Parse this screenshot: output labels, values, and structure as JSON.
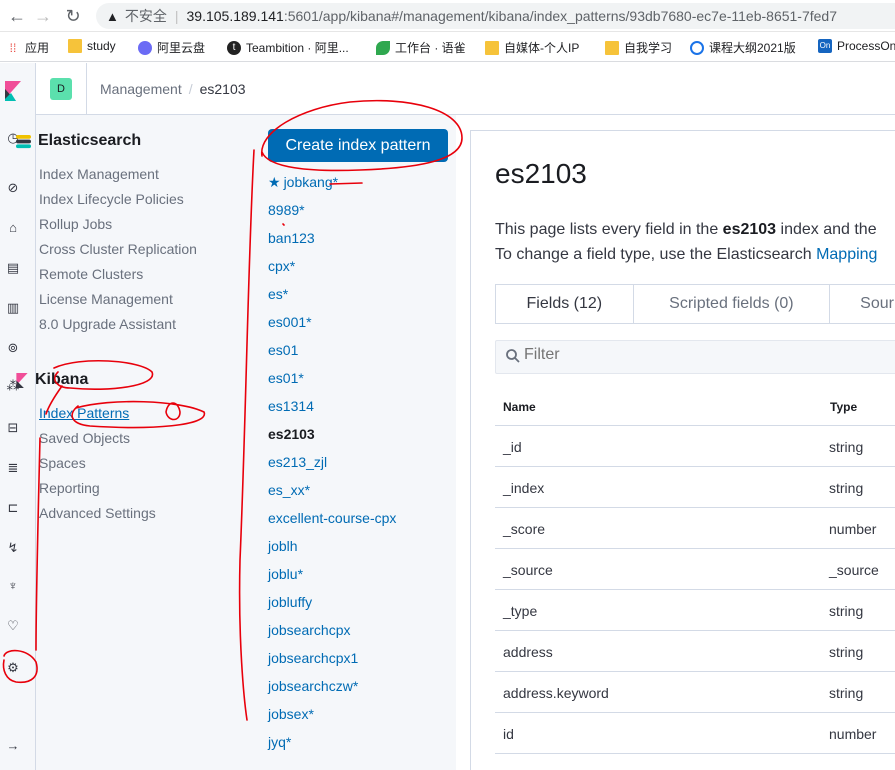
{
  "browser": {
    "insecure_label": "不安全",
    "url_host": "39.105.189.141",
    "url_path": ":5601/app/kibana#/management/kibana/index_patterns/93db7680-ec7e-11eb-8651-7fed7",
    "bookmarks": [
      "应用",
      "study",
      "阿里云盘",
      "Teambition · 阿里...",
      "工作台 · 语雀",
      "自媒体-个人IP",
      "自我学习",
      "课程大纲2021版",
      "ProcessOn"
    ]
  },
  "header": {
    "space_initial": "D",
    "breadcrumb_management": "Management",
    "breadcrumb_separator": "/",
    "breadcrumb_current": "es2103"
  },
  "sidenav": {
    "elasticsearch_title": "Elasticsearch",
    "elasticsearch_items": [
      "Index Management",
      "Index Lifecycle Policies",
      "Rollup Jobs",
      "Cross Cluster Replication",
      "Remote Clusters",
      "License Management",
      "8.0 Upgrade Assistant"
    ],
    "kibana_title": "Kibana",
    "kibana_items": [
      "Index Patterns",
      "Saved Objects",
      "Spaces",
      "Reporting",
      "Advanced Settings"
    ]
  },
  "patterns": {
    "create_label": "Create index pattern",
    "items": [
      "jobkang*",
      "8989*",
      "ban123",
      "cpx*",
      "es*",
      "es001*",
      "es01",
      "es01*",
      "es1314",
      "es2103",
      "es213_zjl",
      "es_xx*",
      "excellent-course-cpx",
      "joblh",
      "joblu*",
      "jobluffy",
      "jobsearchcpx",
      "jobsearchcpx1",
      "jobsearchczw*",
      "jobsex*",
      "jyq*"
    ],
    "current": "es2103"
  },
  "main": {
    "title": "es2103",
    "desc1_a": "This page lists every field in the ",
    "desc1_b": "es2103",
    "desc1_c": " index and the",
    "desc2_a": "To change a field type, use the Elasticsearch ",
    "desc2_link": "Mapping",
    "tabs": [
      "Fields (12)",
      "Scripted fields (0)",
      "Sour"
    ],
    "filter_placeholder": "Filter",
    "col_name": "Name",
    "col_type": "Type",
    "rows": [
      {
        "name": "_id",
        "type": "string"
      },
      {
        "name": "_index",
        "type": "string"
      },
      {
        "name": "_score",
        "type": "number"
      },
      {
        "name": "_source",
        "type": "_source"
      },
      {
        "name": "_type",
        "type": "string"
      },
      {
        "name": "address",
        "type": "string"
      },
      {
        "name": "address.keyword",
        "type": "string"
      },
      {
        "name": "id",
        "type": "number"
      }
    ]
  },
  "colors": {
    "primary": "#006bb4",
    "annotation": "#e8000b",
    "space_avatar": "#5be0ad"
  }
}
